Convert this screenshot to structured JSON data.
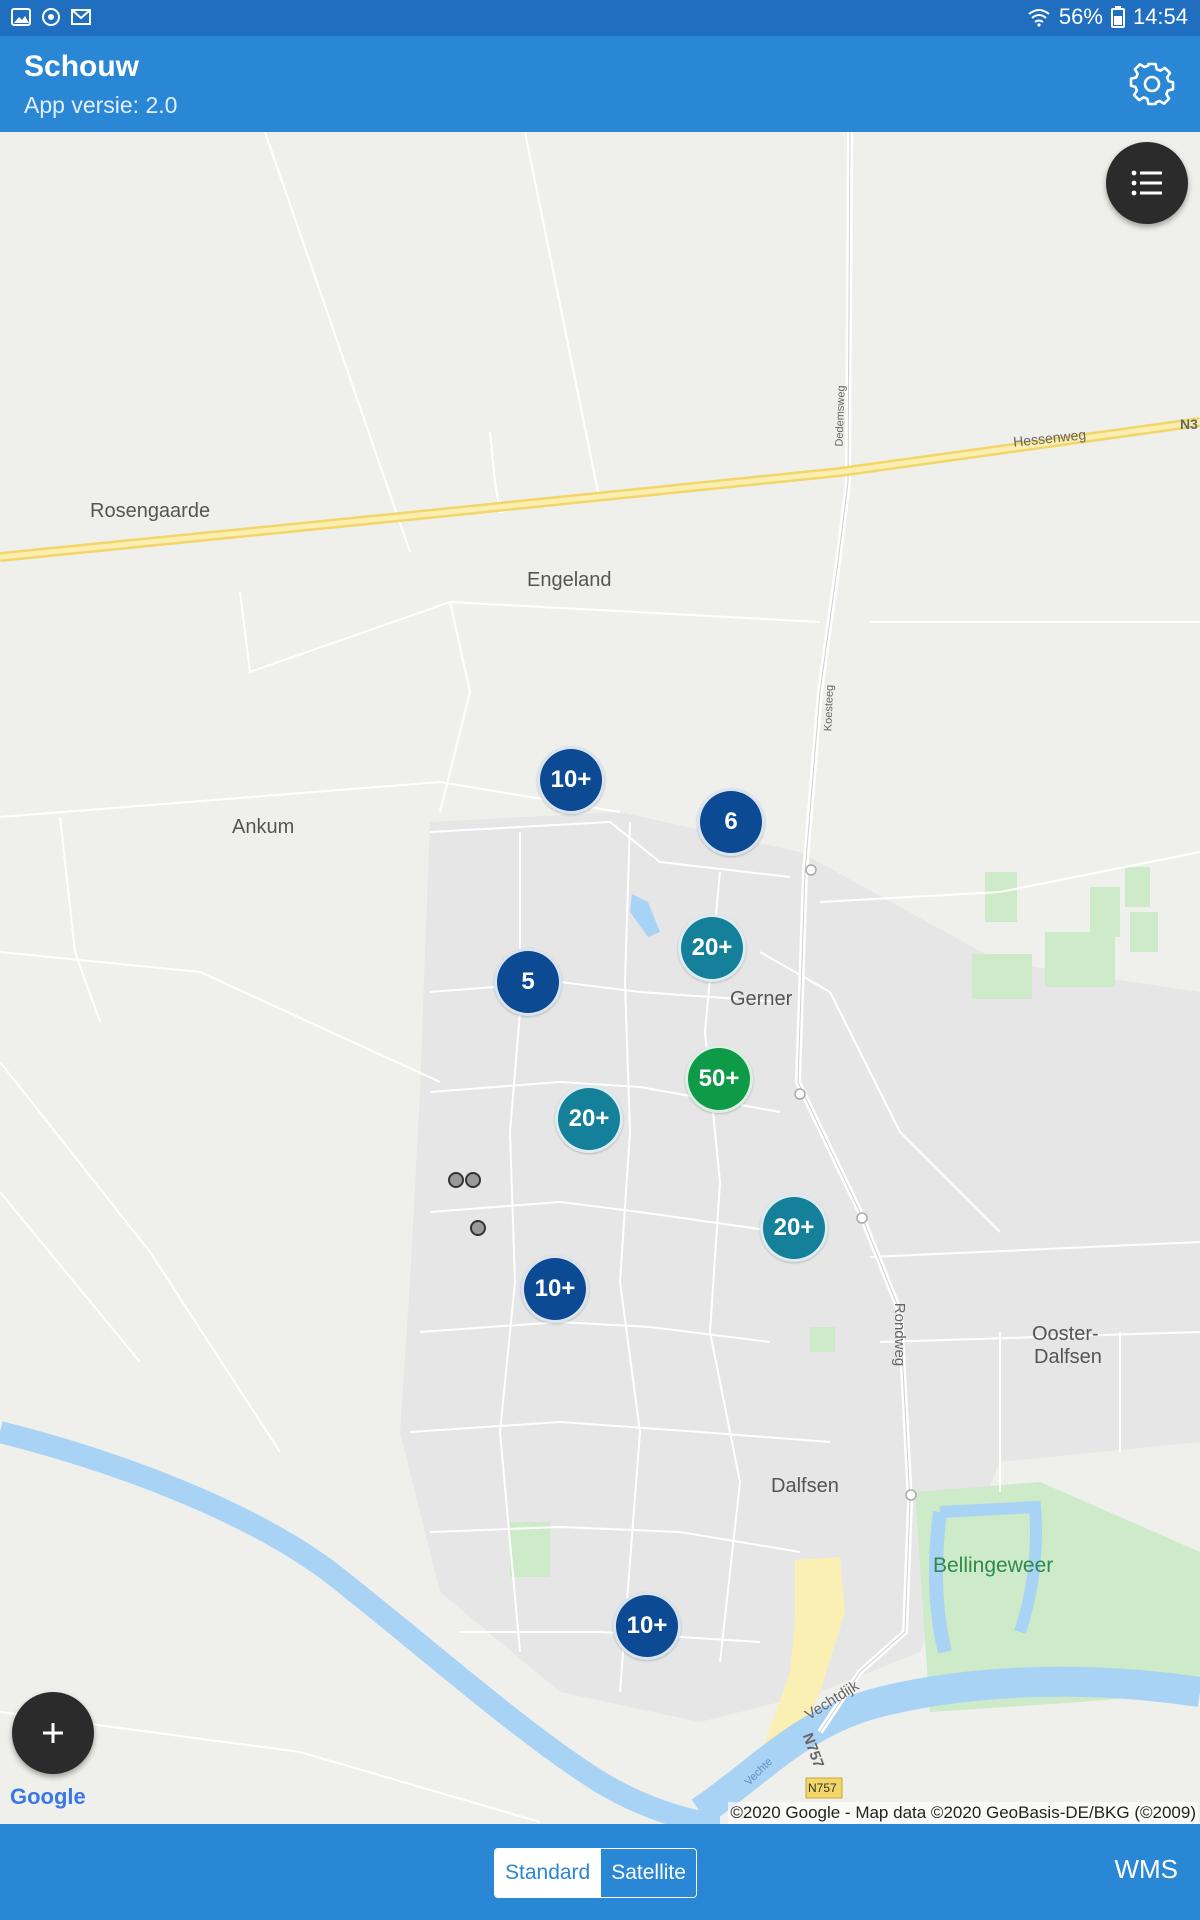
{
  "status_bar": {
    "battery": "56%",
    "time": "14:54"
  },
  "app_bar": {
    "title": "Schouw",
    "subtitle": "App versie: 2.0"
  },
  "map": {
    "place_labels": {
      "rosengaarde": "Rosengaarde",
      "engeland": "Engeland",
      "ankum": "Ankum",
      "gerner": "Gerner",
      "ooster_dalfsen_1": "Ooster-",
      "ooster_dalfsen_2": "Dalfsen",
      "dalfsen": "Dalfsen",
      "bellingeweer": "Bellingeweer"
    },
    "road_labels": {
      "hessenweg": "Hessenweg",
      "n3": "N3",
      "dedemsweg": "Dedemsweg",
      "koesteeg": "Koesteeg",
      "rondweg": "Rondweg",
      "vechtdijk": "Vechtdijk",
      "n757_a": "N757",
      "n757_b": "N757",
      "vechte": "Vechte"
    },
    "clusters": [
      "10+",
      "6",
      "20+",
      "5",
      "50+",
      "20+",
      "20+",
      "10+",
      "10+"
    ],
    "google_logo": "Google",
    "attribution": "©2020 Google - Map data ©2020 GeoBasis-DE/BKG (©2009)"
  },
  "bottom_bar": {
    "map_types": [
      "Standard",
      "Satellite"
    ],
    "selected_map_type": "Standard",
    "wms_label": "WMS"
  },
  "colors": {
    "status_bar": "#1f6ebf",
    "app_bar": "#2a87d6",
    "cluster_navy": "#0c4a94",
    "cluster_teal": "#14809a",
    "cluster_green": "#0f9a48",
    "water": "#a9d3f5",
    "highway": "#f6e08a",
    "park": "#cdeac9"
  },
  "icons": {
    "status_left": [
      "gallery-icon",
      "sync-icon",
      "email-icon"
    ],
    "status_right": [
      "wifi-icon",
      "battery-icon"
    ],
    "settings": "gear-icon",
    "list_fab": "list-icon",
    "add_fab": "plus-icon"
  }
}
